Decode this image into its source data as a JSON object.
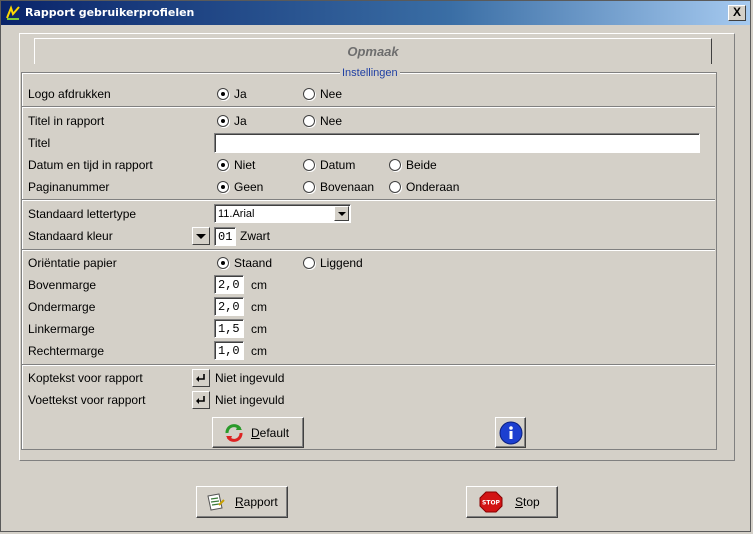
{
  "window": {
    "title": "Rapport gebruikerprofielen",
    "close_label": "X"
  },
  "tab": {
    "label": "Opmaak"
  },
  "group": {
    "legend": "Instellingen"
  },
  "logo": {
    "label": "Logo afdrukken",
    "options": [
      "Ja",
      "Nee"
    ],
    "selected": "Ja"
  },
  "titel_in_rapport": {
    "label": "Titel in rapport",
    "options": [
      "Ja",
      "Nee"
    ],
    "selected": "Ja"
  },
  "titel": {
    "label": "Titel",
    "value": ""
  },
  "datum": {
    "label": "Datum en tijd in rapport",
    "options": [
      "Niet",
      "Datum",
      "Beide"
    ],
    "selected": "Niet"
  },
  "pagina": {
    "label": "Paginanummer",
    "options": [
      "Geen",
      "Bovenaan",
      "Onderaan"
    ],
    "selected": "Geen"
  },
  "lettertype": {
    "label": "Standaard lettertype",
    "value": "11.Arial"
  },
  "kleur": {
    "label": "Standaard kleur",
    "code": "01",
    "name": "Zwart"
  },
  "orientatie": {
    "label": "Oriëntatie papier",
    "options": [
      "Staand",
      "Liggend"
    ],
    "selected": "Staand"
  },
  "marges": [
    {
      "label": "Bovenmarge",
      "value": "2,0",
      "unit": "cm"
    },
    {
      "label": "Ondermarge",
      "value": "2,0",
      "unit": "cm"
    },
    {
      "label": "Linkermarge",
      "value": "1,5",
      "unit": "cm"
    },
    {
      "label": "Rechtermarge",
      "value": "1,0",
      "unit": "cm"
    }
  ],
  "koptekst": {
    "label": "Koptekst voor rapport",
    "value": "Niet ingevuld",
    "icon": "enter-icon"
  },
  "voettekst": {
    "label": "Voettekst voor rapport",
    "value": "Niet ingevuld",
    "icon": "enter-icon"
  },
  "buttons": {
    "default_first": "D",
    "default_rest": "efault",
    "rapport_first": "R",
    "rapport_rest": "apport",
    "stop_first": "S",
    "stop_rest": "top",
    "stop_sign_text": "STOP"
  },
  "colors": {
    "titlebar": "#0a246a",
    "accent": "#1f3fa3",
    "face": "#d4d0c8"
  }
}
